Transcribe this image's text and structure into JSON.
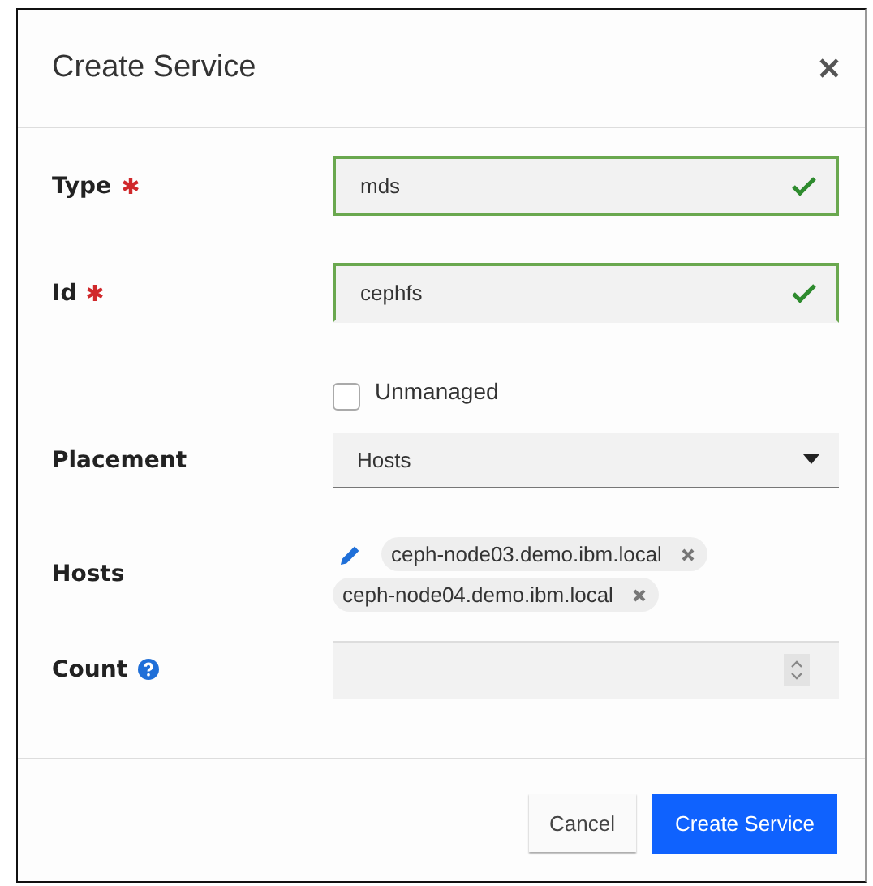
{
  "dialog": {
    "title": "Create Service"
  },
  "fields": [
    {
      "kind": "text",
      "label": "Type",
      "required": true,
      "value": "mds",
      "valid": true
    },
    {
      "kind": "text",
      "label": "Id",
      "required": true,
      "value": "cephfs",
      "valid": true
    },
    {
      "kind": "checkbox",
      "label": "Unmanaged",
      "checked": false
    },
    {
      "kind": "select",
      "label": "Placement",
      "value": "Hosts"
    },
    {
      "kind": "chips",
      "label": "Hosts",
      "chips": [
        "ceph-node03.demo.ibm.local",
        "ceph-node04.demo.ibm.local"
      ]
    },
    {
      "kind": "number",
      "label": "Count",
      "help": true
    }
  ],
  "buttons": [
    {
      "label": "Cancel",
      "primary": false
    },
    {
      "label": "Create Service",
      "primary": true
    }
  ]
}
